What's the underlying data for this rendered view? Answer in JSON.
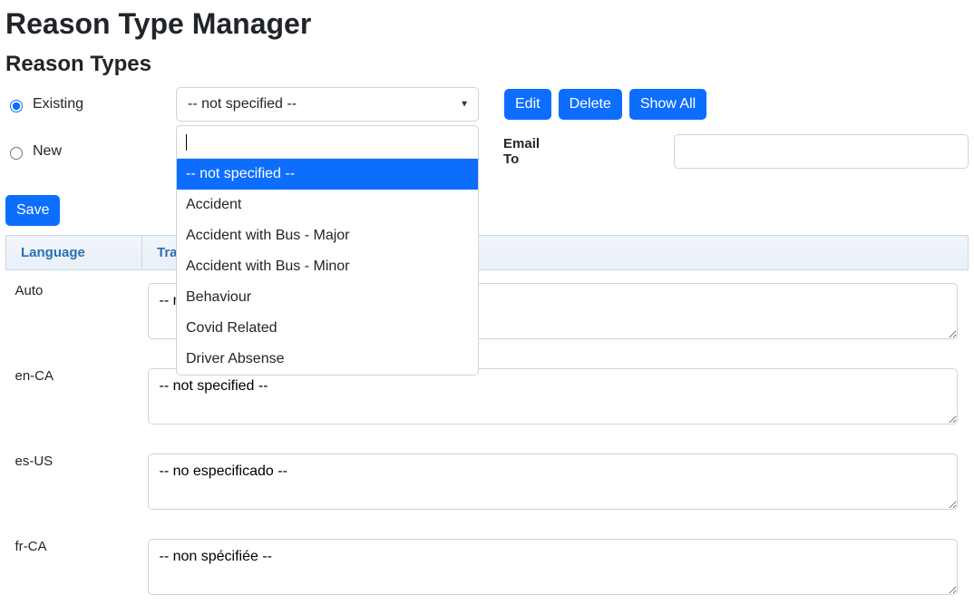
{
  "page": {
    "title": "Reason Type Manager",
    "subtitle": "Reason Types"
  },
  "mode": {
    "existing": "Existing",
    "new": "New"
  },
  "select": {
    "display": "-- not specified --",
    "search": "",
    "options": [
      "-- not specified --",
      "Accident",
      "Accident with Bus - Major",
      "Accident with Bus - Minor",
      "Behaviour",
      "Covid Related",
      "Driver Absense"
    ]
  },
  "buttons": {
    "edit": "Edit",
    "delete": "Delete",
    "showAll": "Show All",
    "save": "Save"
  },
  "email": {
    "label": "Email To",
    "value": ""
  },
  "table": {
    "headers": {
      "lang": "Language",
      "trans": "Translated Text"
    },
    "rows": [
      {
        "lang": "Auto",
        "text": "-- not specified --"
      },
      {
        "lang": "en-CA",
        "text": "-- not specified --"
      },
      {
        "lang": "es-US",
        "text": "-- no especificado --"
      },
      {
        "lang": "fr-CA",
        "text": "-- non spécifiée --"
      }
    ]
  }
}
